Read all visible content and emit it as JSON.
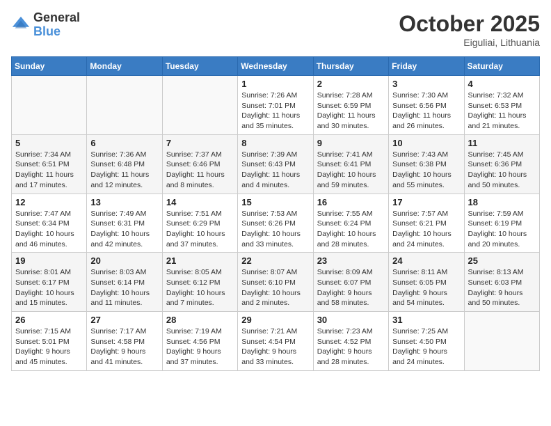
{
  "logo": {
    "general": "General",
    "blue": "Blue"
  },
  "title": "October 2025",
  "location": "Eiguliai, Lithuania",
  "days_header": [
    "Sunday",
    "Monday",
    "Tuesday",
    "Wednesday",
    "Thursday",
    "Friday",
    "Saturday"
  ],
  "weeks": [
    [
      {
        "day": "",
        "info": ""
      },
      {
        "day": "",
        "info": ""
      },
      {
        "day": "",
        "info": ""
      },
      {
        "day": "1",
        "info": "Sunrise: 7:26 AM\nSunset: 7:01 PM\nDaylight: 11 hours\nand 35 minutes."
      },
      {
        "day": "2",
        "info": "Sunrise: 7:28 AM\nSunset: 6:59 PM\nDaylight: 11 hours\nand 30 minutes."
      },
      {
        "day": "3",
        "info": "Sunrise: 7:30 AM\nSunset: 6:56 PM\nDaylight: 11 hours\nand 26 minutes."
      },
      {
        "day": "4",
        "info": "Sunrise: 7:32 AM\nSunset: 6:53 PM\nDaylight: 11 hours\nand 21 minutes."
      }
    ],
    [
      {
        "day": "5",
        "info": "Sunrise: 7:34 AM\nSunset: 6:51 PM\nDaylight: 11 hours\nand 17 minutes."
      },
      {
        "day": "6",
        "info": "Sunrise: 7:36 AM\nSunset: 6:48 PM\nDaylight: 11 hours\nand 12 minutes."
      },
      {
        "day": "7",
        "info": "Sunrise: 7:37 AM\nSunset: 6:46 PM\nDaylight: 11 hours\nand 8 minutes."
      },
      {
        "day": "8",
        "info": "Sunrise: 7:39 AM\nSunset: 6:43 PM\nDaylight: 11 hours\nand 4 minutes."
      },
      {
        "day": "9",
        "info": "Sunrise: 7:41 AM\nSunset: 6:41 PM\nDaylight: 10 hours\nand 59 minutes."
      },
      {
        "day": "10",
        "info": "Sunrise: 7:43 AM\nSunset: 6:38 PM\nDaylight: 10 hours\nand 55 minutes."
      },
      {
        "day": "11",
        "info": "Sunrise: 7:45 AM\nSunset: 6:36 PM\nDaylight: 10 hours\nand 50 minutes."
      }
    ],
    [
      {
        "day": "12",
        "info": "Sunrise: 7:47 AM\nSunset: 6:34 PM\nDaylight: 10 hours\nand 46 minutes."
      },
      {
        "day": "13",
        "info": "Sunrise: 7:49 AM\nSunset: 6:31 PM\nDaylight: 10 hours\nand 42 minutes."
      },
      {
        "day": "14",
        "info": "Sunrise: 7:51 AM\nSunset: 6:29 PM\nDaylight: 10 hours\nand 37 minutes."
      },
      {
        "day": "15",
        "info": "Sunrise: 7:53 AM\nSunset: 6:26 PM\nDaylight: 10 hours\nand 33 minutes."
      },
      {
        "day": "16",
        "info": "Sunrise: 7:55 AM\nSunset: 6:24 PM\nDaylight: 10 hours\nand 28 minutes."
      },
      {
        "day": "17",
        "info": "Sunrise: 7:57 AM\nSunset: 6:21 PM\nDaylight: 10 hours\nand 24 minutes."
      },
      {
        "day": "18",
        "info": "Sunrise: 7:59 AM\nSunset: 6:19 PM\nDaylight: 10 hours\nand 20 minutes."
      }
    ],
    [
      {
        "day": "19",
        "info": "Sunrise: 8:01 AM\nSunset: 6:17 PM\nDaylight: 10 hours\nand 15 minutes."
      },
      {
        "day": "20",
        "info": "Sunrise: 8:03 AM\nSunset: 6:14 PM\nDaylight: 10 hours\nand 11 minutes."
      },
      {
        "day": "21",
        "info": "Sunrise: 8:05 AM\nSunset: 6:12 PM\nDaylight: 10 hours\nand 7 minutes."
      },
      {
        "day": "22",
        "info": "Sunrise: 8:07 AM\nSunset: 6:10 PM\nDaylight: 10 hours\nand 2 minutes."
      },
      {
        "day": "23",
        "info": "Sunrise: 8:09 AM\nSunset: 6:07 PM\nDaylight: 9 hours\nand 58 minutes."
      },
      {
        "day": "24",
        "info": "Sunrise: 8:11 AM\nSunset: 6:05 PM\nDaylight: 9 hours\nand 54 minutes."
      },
      {
        "day": "25",
        "info": "Sunrise: 8:13 AM\nSunset: 6:03 PM\nDaylight: 9 hours\nand 50 minutes."
      }
    ],
    [
      {
        "day": "26",
        "info": "Sunrise: 7:15 AM\nSunset: 5:01 PM\nDaylight: 9 hours\nand 45 minutes."
      },
      {
        "day": "27",
        "info": "Sunrise: 7:17 AM\nSunset: 4:58 PM\nDaylight: 9 hours\nand 41 minutes."
      },
      {
        "day": "28",
        "info": "Sunrise: 7:19 AM\nSunset: 4:56 PM\nDaylight: 9 hours\nand 37 minutes."
      },
      {
        "day": "29",
        "info": "Sunrise: 7:21 AM\nSunset: 4:54 PM\nDaylight: 9 hours\nand 33 minutes."
      },
      {
        "day": "30",
        "info": "Sunrise: 7:23 AM\nSunset: 4:52 PM\nDaylight: 9 hours\nand 28 minutes."
      },
      {
        "day": "31",
        "info": "Sunrise: 7:25 AM\nSunset: 4:50 PM\nDaylight: 9 hours\nand 24 minutes."
      },
      {
        "day": "",
        "info": ""
      }
    ]
  ]
}
